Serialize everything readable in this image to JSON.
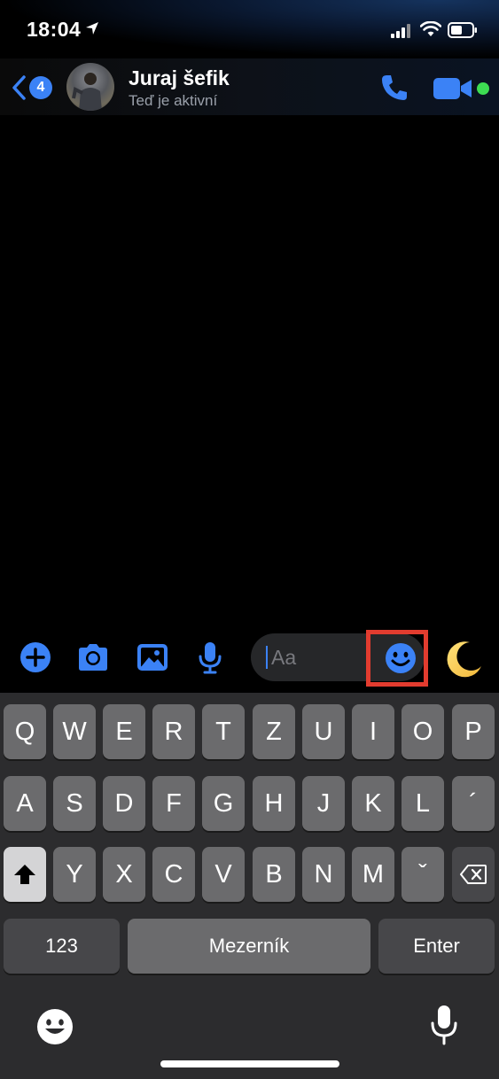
{
  "status": {
    "time": "18:04"
  },
  "header": {
    "back_badge": "4",
    "name": "Juraj šefik",
    "subtitle": "Teď je aktivní"
  },
  "composer": {
    "placeholder": "Aa"
  },
  "keyboard": {
    "row1": [
      "Q",
      "W",
      "E",
      "R",
      "T",
      "Z",
      "U",
      "I",
      "O",
      "P"
    ],
    "row2": [
      "A",
      "S",
      "D",
      "F",
      "G",
      "H",
      "J",
      "K",
      "L",
      "´"
    ],
    "row3": [
      "Y",
      "X",
      "C",
      "V",
      "B",
      "N",
      "M",
      "ˇ"
    ],
    "numbers": "123",
    "space": "Mezerník",
    "enter": "Enter"
  },
  "colors": {
    "accent": "#3b82f6",
    "online": "#3ddc52",
    "highlight": "#e23c2f"
  }
}
